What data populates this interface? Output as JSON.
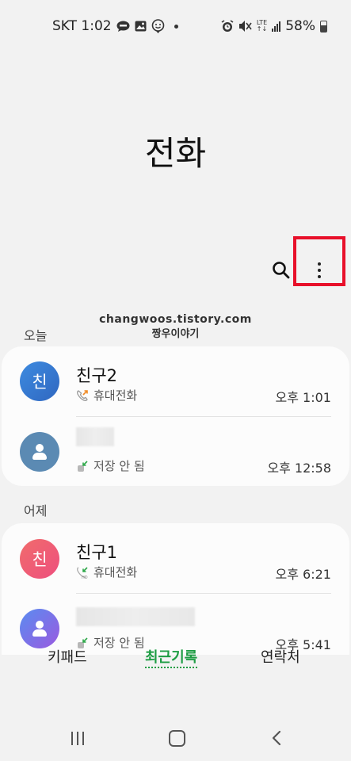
{
  "status_bar": {
    "carrier_time": "SKT 1:02",
    "lte_label": "LTE",
    "battery": "58%"
  },
  "header": {
    "title": "전화"
  },
  "watermark": {
    "line1": "changwoos.tistory.com",
    "line2": "짱우이야기"
  },
  "sections": [
    {
      "label": "오늘",
      "calls": [
        {
          "name": "친구2",
          "avatar_text": "친",
          "type": "휴대전화",
          "time": "오후 1:01",
          "call_direction": "outgoing"
        },
        {
          "name": "",
          "avatar_text": "",
          "type": "저장 안 됨",
          "time": "오후 12:58",
          "call_direction": "incoming"
        }
      ]
    },
    {
      "label": "어제",
      "calls": [
        {
          "name": "친구1",
          "avatar_text": "친",
          "type": "휴대전화",
          "time": "오후 6:21",
          "call_direction": "incoming-hd"
        },
        {
          "name": "",
          "avatar_text": "",
          "type": "저장 안 됨",
          "time": "오후 5:41",
          "call_direction": "incoming"
        }
      ]
    }
  ],
  "tabs": [
    {
      "label": "키패드",
      "active": false
    },
    {
      "label": "최근기록",
      "active": true
    },
    {
      "label": "연락처",
      "active": false
    }
  ],
  "colors": {
    "accent": "#1e9d44",
    "highlight": "#e8102a",
    "outgoing_call": "#f08a24",
    "incoming_call": "#2ea84a"
  }
}
